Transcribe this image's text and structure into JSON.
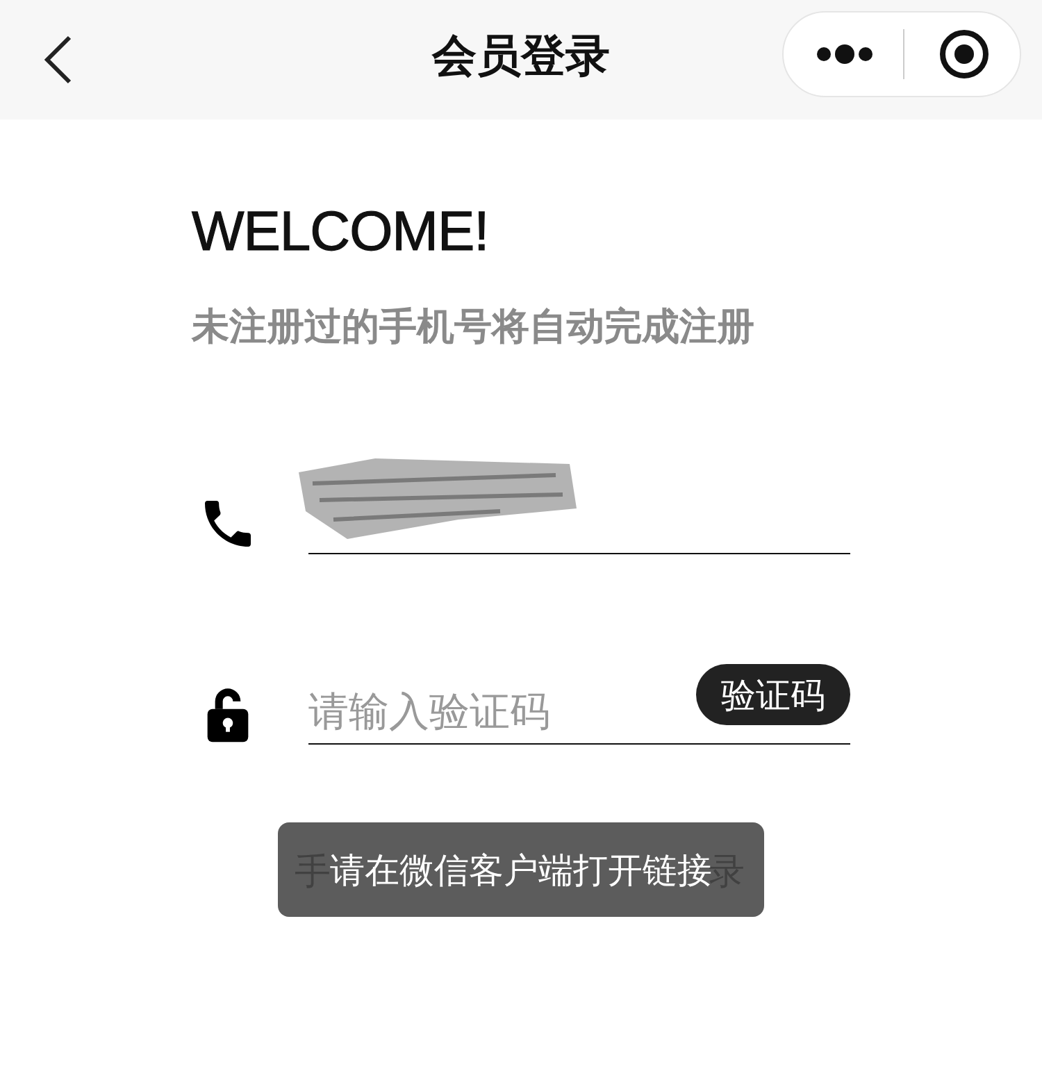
{
  "nav_bar": {
    "title": "会员登录"
  },
  "heading": "WELCOME!",
  "subtitle": "未注册过的手机号将自动完成注册",
  "phone_field": {
    "redacted": true
  },
  "code_field": {
    "placeholder": "请输入验证码",
    "button": "验证码"
  },
  "login_options_visible": [
    "手",
    "录"
  ],
  "toast": {
    "text": "请在微信客户端打开链接"
  }
}
